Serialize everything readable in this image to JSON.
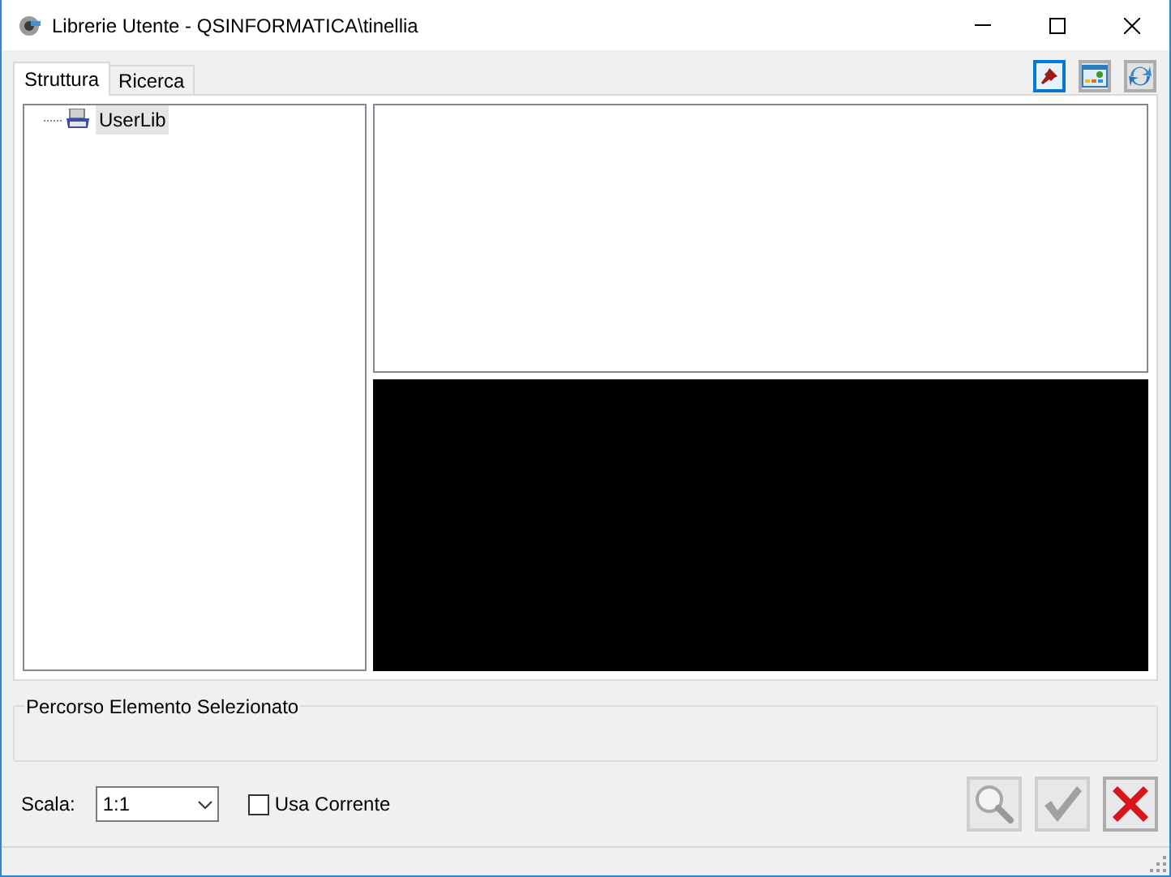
{
  "window": {
    "title": "Librerie Utente - QSINFORMATICA\\tinellia"
  },
  "tabs": [
    {
      "label": "Struttura",
      "selected": true
    },
    {
      "label": "Ricerca",
      "selected": false
    }
  ],
  "toolbar": [
    {
      "kind": "pin",
      "selected": true
    },
    {
      "kind": "picture",
      "selected": false
    },
    {
      "kind": "refresh",
      "selected": false
    }
  ],
  "tree": [
    {
      "label": "UserLib",
      "selected": true
    }
  ],
  "path_group": {
    "label": "Percorso Elemento Selezionato"
  },
  "scale": {
    "label": "Scala:",
    "value": "1:1"
  },
  "use_current": {
    "label": "Usa Corrente",
    "checked": false
  },
  "actions": [
    {
      "kind": "search",
      "disabled": true
    },
    {
      "kind": "confirm",
      "disabled": true
    },
    {
      "kind": "cancel",
      "disabled": false
    }
  ]
}
